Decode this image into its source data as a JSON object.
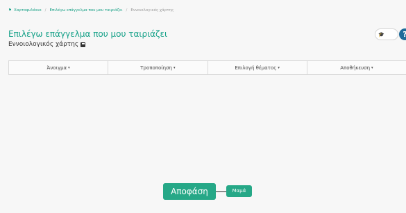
{
  "breadcrumb": {
    "home_icon": "home-icon",
    "items": [
      "Χαρτοφυλάκιο",
      "Επιλέγω επάγγελμα που μου ταιριάζει",
      "Εννοιολογικός χάρτης"
    ]
  },
  "header": {
    "title": "Επιλέγω επάγγελμα που μου ταιριάζει",
    "subtitle": "Εννοιολογικός χάρτης",
    "subtitle_icon": "save-icon"
  },
  "toggle": {
    "icon": "graduation-cap-icon",
    "glyph": "🎓"
  },
  "help": {
    "label": "?"
  },
  "menu": {
    "items": [
      {
        "label": "Άνοιγμα",
        "caret": "▾"
      },
      {
        "label": "Τροποποίηση",
        "caret": "▾"
      },
      {
        "label": "Επιλογή θέματος",
        "caret": "▾"
      },
      {
        "label": "Αποθήκευση",
        "caret": "▾"
      }
    ]
  },
  "mindmap": {
    "root": "Αποφάση",
    "child": "Μαμά"
  },
  "colors": {
    "accent": "#13a087",
    "node": "#26a887",
    "help": "#1f6b9a"
  }
}
